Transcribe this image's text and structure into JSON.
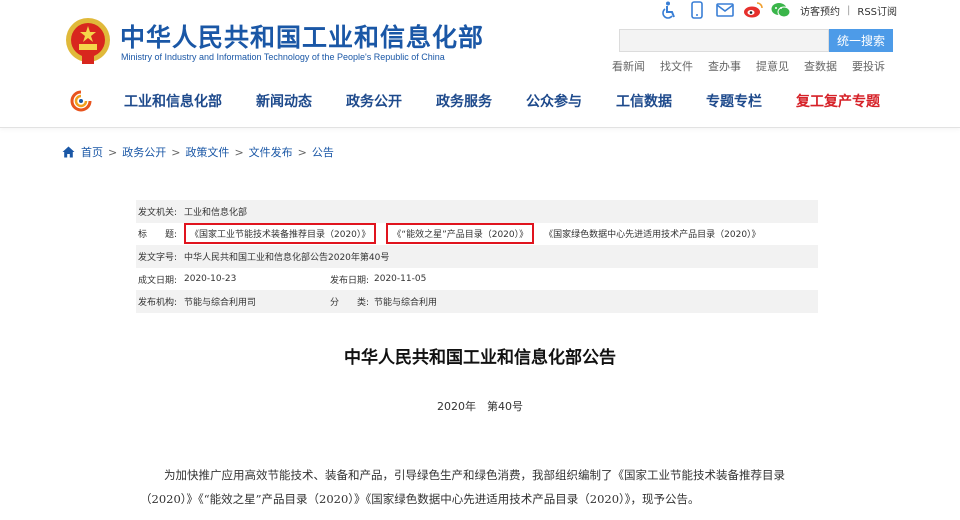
{
  "header": {
    "site_title": "中华人民共和国工业和信息化部",
    "site_subtitle": "Ministry of Industry and Information Technology of the People's Republic of China",
    "top_icons": [
      "accessibility-icon",
      "mobile-icon",
      "mail-icon",
      "weibo-icon",
      "wechat-icon"
    ],
    "visitor_booking": "访客预约",
    "top_sep": "|",
    "rss": "RSS订阅",
    "search_placeholder": "",
    "search_button": "统一搜索",
    "quick_links": [
      "看新闻",
      "找文件",
      "查办事",
      "提意见",
      "查数据",
      "要投诉"
    ]
  },
  "nav": {
    "items": [
      "工业和信息化部",
      "新闻动态",
      "政务公开",
      "政务服务",
      "公众参与",
      "工信数据",
      "专题专栏",
      "复工复产专题"
    ],
    "highlight_color": "#d62128",
    "primary_color": "#1e4a8c"
  },
  "breadcrumb": {
    "items": [
      "首页",
      "政务公开",
      "政策文件",
      "文件发布",
      "公告"
    ],
    "sep": ">"
  },
  "info": {
    "issuer_label": "发文机关:",
    "issuer": "工业和信息化部",
    "title_label": "标　　题:",
    "titles": [
      "《国家工业节能技术装备推荐目录（2020）》",
      "《“能效之星”产品目录（2020）》",
      "《国家绿色数据中心先进适用技术产品目录（2020）》"
    ],
    "doc_no_label": "发文字号:",
    "doc_no": "中华人民共和国工业和信息化部公告2020年第40号",
    "created_label": "成文日期:",
    "created": "2020-10-23",
    "published_label": "发布日期:",
    "published": "2020-11-05",
    "agency_label": "发布机构:",
    "agency": "节能与综合利用司",
    "category_label": "分　　类:",
    "category": "节能与综合利用"
  },
  "document": {
    "title": "中华人民共和国工业和信息化部公告",
    "number": "2020年　第40号",
    "paragraph": "为加快推广应用高效节能技术、装备和产品，引导绿色生产和绿色消费，我部组织编制了《国家工业节能技术装备推荐目录（2020）》《“能效之星”产品目录（2020）》《国家绿色数据中心先进适用技术产品目录（2020）》，现予公告。"
  }
}
